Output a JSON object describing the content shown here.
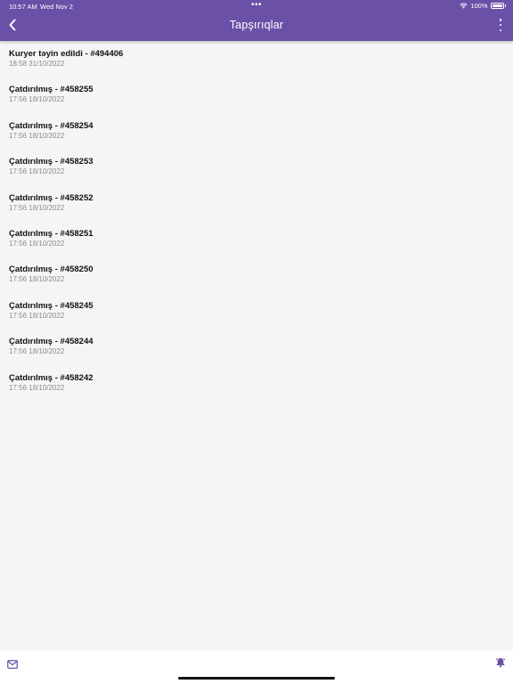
{
  "status_bar": {
    "time": "10:57 AM",
    "date": "Wed Nov 2",
    "battery": "100%"
  },
  "header": {
    "title": "Tapşırıqlar",
    "back_icon": "chevron-left-icon",
    "more_icon": "more-vertical-icon",
    "background_color": "#6a50a7"
  },
  "tasks": [
    {
      "title": "Kuryer təyin edildi - #494406",
      "time": "18:58 31/10/2022"
    },
    {
      "title": "Çatdırılmış - #458255",
      "time": "17:56 18/10/2022"
    },
    {
      "title": "Çatdırılmış - #458254",
      "time": "17:56 18/10/2022"
    },
    {
      "title": "Çatdırılmış - #458253",
      "time": "17:56 18/10/2022"
    },
    {
      "title": "Çatdırılmış - #458252",
      "time": "17:56 18/10/2022"
    },
    {
      "title": "Çatdırılmış - #458251",
      "time": "17:56 18/10/2022"
    },
    {
      "title": "Çatdırılmış - #458250",
      "time": "17:56 18/10/2022"
    },
    {
      "title": "Çatdırılmış - #458245",
      "time": "17:56 18/10/2022"
    },
    {
      "title": "Çatdırılmış - #458244",
      "time": "17:56 18/10/2022"
    },
    {
      "title": "Çatdırılmış - #458242",
      "time": "17:56 18/10/2022"
    }
  ],
  "bottom_bar": {
    "mail_icon": "mail-icon",
    "bell_icon": "bell-icon",
    "accent_color": "#6a50a7"
  }
}
